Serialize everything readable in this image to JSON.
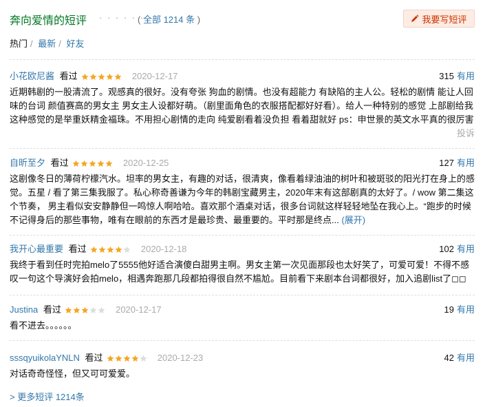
{
  "header": {
    "title": "奔向爱情的短评",
    "dots": "· · · · · ·",
    "count_prefix": "(",
    "count_link": "全部 1214 条",
    "count_suffix": ")",
    "write_label": "我要写短评",
    "pencil_icon": "pencil-icon"
  },
  "tabs": [
    {
      "label": "热门",
      "active": true
    },
    {
      "label": "最新",
      "active": false
    },
    {
      "label": "好友",
      "active": false
    }
  ],
  "colors": {
    "green_title": "#007722",
    "link": "#3377aa",
    "star": "#f5a623",
    "star_empty": "#dddddd"
  },
  "comments": [
    {
      "user": "小花欧尼酱",
      "watched": "看过",
      "rating": 5,
      "date": "2020-12-17",
      "useful_count": "315",
      "useful_label": "有用",
      "content": "近期韩剧的一股清流了。观感真的很好。没有夸张 狗血的剧情。也没有超能力 有缺陷的主人公。轻松的剧情 能让人回味的台词 颜值赛高的男女主 男女主人设都好萌。（剧里面角色的衣服搭配都好好看）。给人一种特别的感觉 上部剧给我这种感觉的是举重妖精金福珠。不用担心剧情的走向 纯爱剧看着没负担 看着甜就好 ps：申世景的英文水平真的很厉害",
      "report": "投诉"
    },
    {
      "user": "自昕至夕",
      "watched": "看过",
      "rating": 5,
      "date": "2020-12-25",
      "useful_count": "127",
      "useful_label": "有用",
      "content": "这剧像冬日的薄荷柠檬汽水。坦率的男女主，有趣的对话，很清爽，像看着绿油油的树叶和被斑驳的阳光打在身上的感觉。五星 / 看了第三集我服了。私心称奇善谦为今年的韩剧宝藏男主，2020年末有这部剧真的太好了。/ wow 第二集这个节奏， 男主看似安安静静但一鸣惊人啊哈哈。喜欢那个酒桌对话，很多台词就这样轻轻地坠在我心上。“跑步的时候不记得身后的那些事物，唯有在眼前的东西才是最珍贵、最重要的。平时那是终点...",
      "expand": "(展开)"
    },
    {
      "user": "我开心最重要",
      "watched": "看过",
      "rating": 4,
      "date": "2020-12-18",
      "useful_count": "102",
      "useful_label": "有用",
      "content": "我终于看到任时完拍melo了5555他好适合演傻白甜男主啊。男女主第一次见面那段也太好笑了，可爱可爱！不得不感叹一句这个导演好会拍melo，相遇奔跑那几段都拍得很自然不尴尬。目前看下来剧本台词都很好，加入追剧list了◻◻"
    },
    {
      "user": "Justina",
      "watched": "看过",
      "rating": 3,
      "date": "2020-12-17",
      "useful_count": "19",
      "useful_label": "有用",
      "content": "看不进去。。。。。。"
    },
    {
      "user": "sssqyuikolaYNLN",
      "watched": "看过",
      "rating": 4,
      "date": "2020-12-23",
      "useful_count": "42",
      "useful_label": "有用",
      "content": "对话奇奇怪怪，但又可可爱爱。"
    }
  ],
  "more": {
    "label": "> 更多短评 1214条"
  }
}
